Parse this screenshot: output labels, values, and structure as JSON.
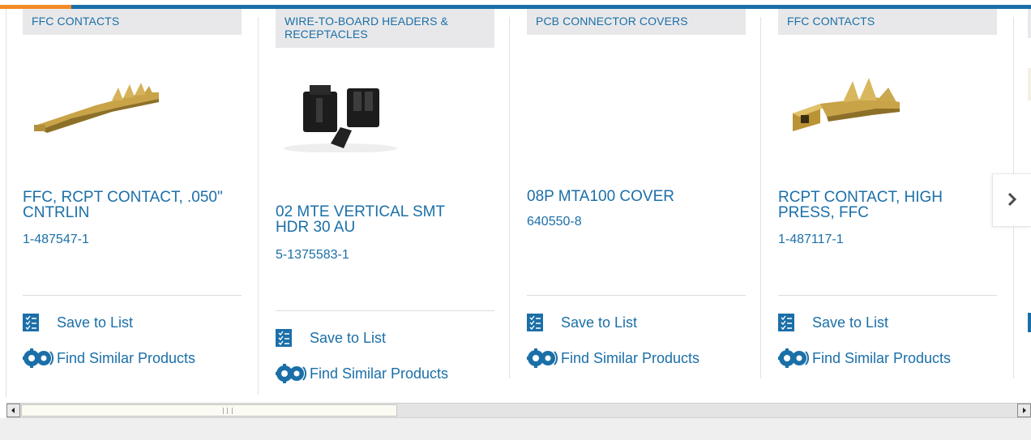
{
  "carousel": {
    "cards": [
      {
        "category": "FFC CONTACTS",
        "title": "FFC, RCPT CONTACT, .050\" CNTRLIN",
        "part_number": "1-487547-1",
        "image": "ffc-contact-image",
        "save_label": "Save to List",
        "similar_label": "Find Similar Products"
      },
      {
        "category": "WIRE-TO-BOARD HEADERS & RECEPTACLES",
        "title": "02 MTE VERTICAL SMT HDR 30 AU",
        "part_number": "5-1375583-1",
        "image": "header-connector-image",
        "save_label": "Save to List",
        "similar_label": "Find Similar Products"
      },
      {
        "category": "PCB CONNECTOR COVERS",
        "title": "08P MTA100 COVER",
        "part_number": "640550-8",
        "image": "",
        "save_label": "Save to List",
        "similar_label": "Find Similar Products"
      },
      {
        "category": "FFC CONTACTS",
        "title": "RCPT CONTACT, HIGH PRESS, FFC",
        "part_number": "1-487117-1",
        "image": "ffc-contact-high-press-image",
        "save_label": "Save to List",
        "similar_label": "Find Similar Products"
      }
    ],
    "next_button_icon": "chevron-right-icon"
  },
  "scrollbar": {
    "left_arrow_icon": "scroll-left-icon",
    "right_arrow_icon": "scroll-right-icon",
    "position_fraction": 0.0
  },
  "colors": {
    "link": "#1b6fa8",
    "accent": "#f28c28",
    "category_bg": "#e8e8ea"
  }
}
